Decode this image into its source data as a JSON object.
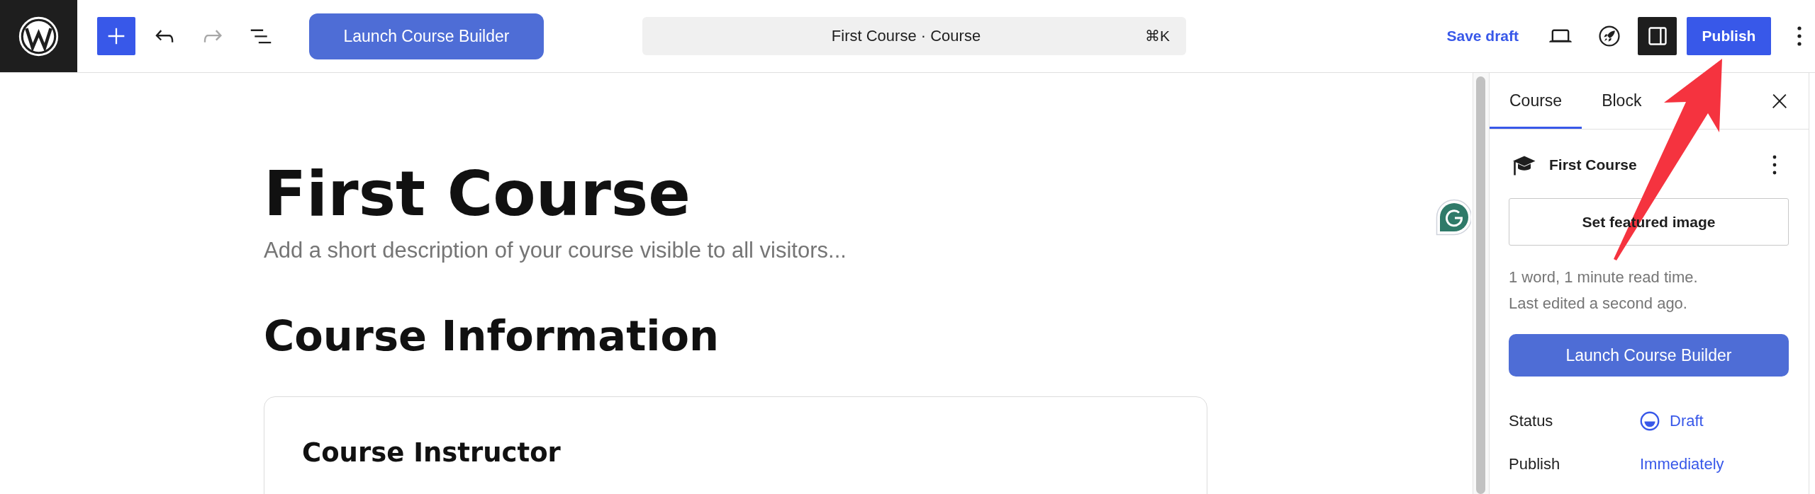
{
  "toolbar": {
    "launch_button": "Launch Course Builder",
    "redo": {
      "disabled": true
    },
    "command_bar": {
      "title": "First Course · Course",
      "shortcut": "⌘K"
    },
    "save_draft": "Save draft",
    "sidebar_toggle": {
      "on": true
    },
    "publish": "Publish"
  },
  "editor": {
    "title": "First Course",
    "description": {
      "placeholder": "Add a short description of your course visible to all visitors..."
    },
    "heading": "Course Information",
    "card": {
      "title": "Course Instructor"
    }
  },
  "sidebar": {
    "tabs": [
      {
        "label": "Course",
        "selected": true
      },
      {
        "label": "Block",
        "selected": false
      }
    ],
    "post": {
      "title": "First Course"
    },
    "featured_image_button": "Set featured image",
    "stats": [
      "1 word, 1 minute read time.",
      "Last edited a second ago."
    ],
    "launch_button": "Launch Course Builder",
    "fields": [
      {
        "label": "Status",
        "value": "Draft",
        "kind": "status"
      },
      {
        "label": "Publish",
        "value": "Immediately",
        "kind": "link"
      }
    ]
  }
}
